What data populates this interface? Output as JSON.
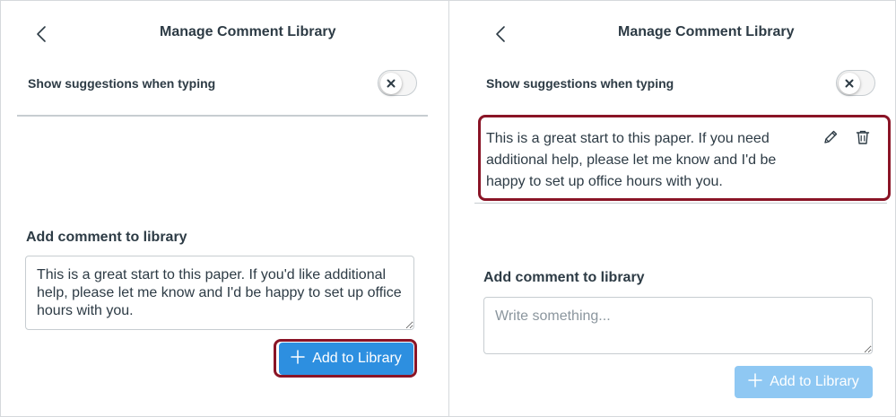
{
  "left": {
    "header": {
      "title": "Manage Comment Library",
      "back_icon": "chevron-left-icon"
    },
    "suggestions": {
      "label": "Show suggestions when typing",
      "toggle_state": "off",
      "toggle_icon": "x-icon"
    },
    "add_section": {
      "heading": "Add comment to library",
      "textarea_value": "This is a great start to this paper. If you'd like additional help, please let me know and I'd be happy to set up office hours with you.",
      "button_label": "Add to Library",
      "button_icon": "plus-icon",
      "button_state": "enabled"
    }
  },
  "right": {
    "header": {
      "title": "Manage Comment Library",
      "back_icon": "chevron-left-icon"
    },
    "suggestions": {
      "label": "Show suggestions when typing",
      "toggle_state": "off",
      "toggle_icon": "x-icon"
    },
    "comments": [
      {
        "text": "This is a great start to this paper. If you need additional help, please let me know and I'd be happy to set up office hours with you.",
        "edit_icon": "pencil-icon",
        "delete_icon": "trash-icon"
      }
    ],
    "add_section": {
      "heading": "Add comment to library",
      "textarea_placeholder": "Write something...",
      "textarea_value": "",
      "button_label": "Add to Library",
      "button_icon": "plus-icon",
      "button_state": "disabled"
    }
  },
  "colors": {
    "text": "#2d3b45",
    "primary": "#2d8fe0",
    "primary_disabled": "#8fc8f3",
    "highlight": "#8a1426",
    "border": "#c7cdd1"
  }
}
